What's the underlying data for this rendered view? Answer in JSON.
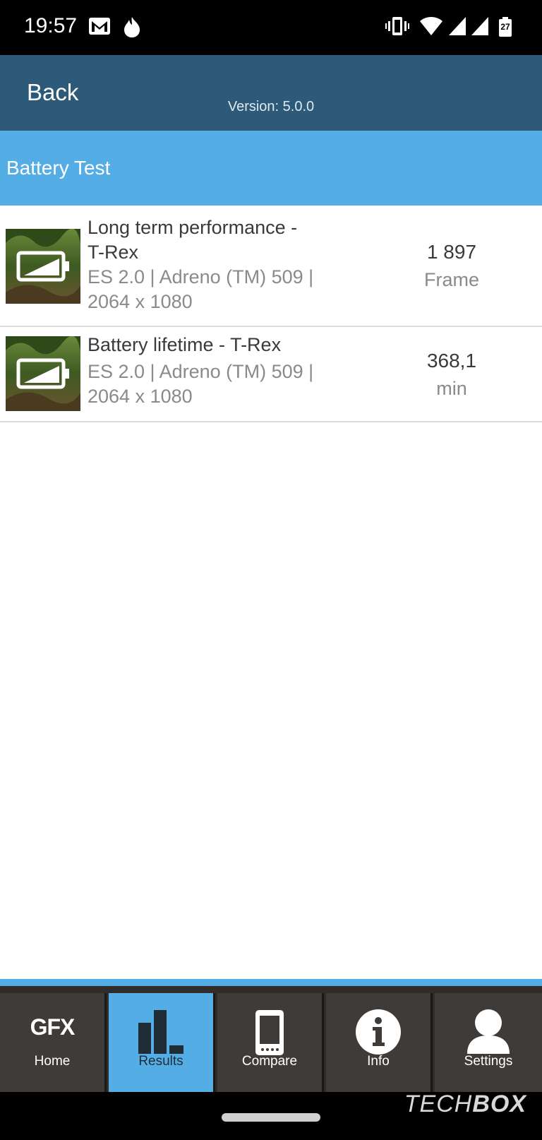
{
  "status_bar": {
    "time": "19:57",
    "battery_level": "27",
    "icons": [
      "gmail-icon",
      "flame-icon",
      "vibrate-icon",
      "wifi-icon",
      "signal-icon",
      "signal-icon",
      "battery-icon"
    ]
  },
  "app_bar": {
    "back_label": "Back",
    "version": "Version: 5.0.0"
  },
  "section": {
    "title": "Battery Test"
  },
  "results": [
    {
      "name_line1": "Long term performance -",
      "name_line2": "T-Rex",
      "details_line1": "ES 2.0 | Adreno (TM) 509 |",
      "details_line2": "2064 x 1080",
      "score": "1 897",
      "unit": "Frame"
    },
    {
      "name_line1": "Battery lifetime - T-Rex",
      "details_line1": "ES 2.0 | Adreno (TM) 509 |",
      "details_line2": "2064 x 1080",
      "score": "368,1",
      "unit": "min"
    }
  ],
  "tabs": [
    {
      "label": "Home",
      "icon": "gfx-logo-icon",
      "logo_text": "GFX",
      "active": false
    },
    {
      "label": "Results",
      "icon": "bar-chart-icon",
      "active": true
    },
    {
      "label": "Compare",
      "icon": "phone-icon",
      "active": false
    },
    {
      "label": "Info",
      "icon": "info-icon",
      "active": false
    },
    {
      "label": "Settings",
      "icon": "user-icon",
      "active": false
    }
  ],
  "watermark": {
    "part1": "TECH",
    "part2": "BOX"
  },
  "colors": {
    "app_bar": "#2c5a78",
    "section": "#55ade5",
    "tab_active": "#55ade5",
    "tab_bg": "#3f3b38"
  }
}
